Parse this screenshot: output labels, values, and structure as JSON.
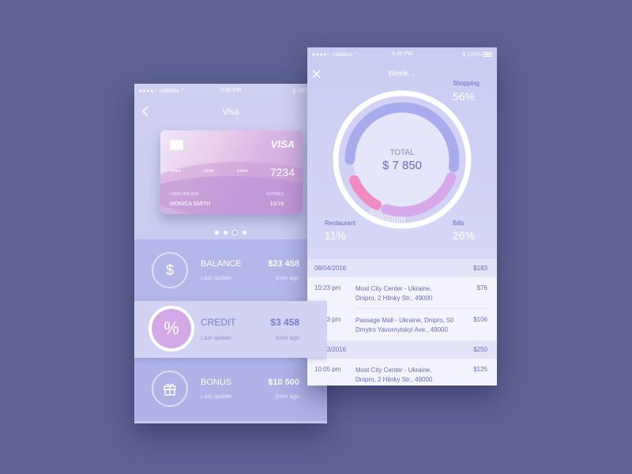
{
  "left_screen": {
    "status": {
      "carrier": "cadabra",
      "time": "9:40 PM",
      "battery": "100%"
    },
    "nav": {
      "title": "Visa"
    },
    "card": {
      "brand": "VISA",
      "masked_groups": [
        "****",
        "****",
        "****"
      ],
      "last_digits": "7234",
      "holder_label": "CARD HOLDER",
      "holder": "MONICA SMITH",
      "expiry_label": "EXPIRES",
      "expiry": "10/19"
    },
    "pager": {
      "count": 4,
      "active_index": 2
    },
    "accounts": [
      {
        "name": "BALANCE",
        "subtitle": "Last update",
        "amount": "$23 458",
        "time": "1min ago",
        "icon": "dollar-icon",
        "glyph": "$"
      },
      {
        "name": "CREDIT",
        "subtitle": "Last update",
        "amount": "$3 458",
        "time": "1min ago",
        "icon": "percent-icon",
        "glyph": "%"
      },
      {
        "name": "BONUS",
        "subtitle": "Last update",
        "amount": "$10 500",
        "time": "2min ago",
        "icon": "gift-icon",
        "glyph": "🎁"
      }
    ]
  },
  "right_screen": {
    "status": {
      "carrier": "cadabra",
      "time": "9:40 PM",
      "battery": "100%"
    },
    "nav": {
      "period": "Week"
    },
    "chart_data": {
      "type": "pie",
      "center_label": "TOTAL",
      "center_value": "$ 7 850",
      "slices": [
        {
          "name": "Shopping",
          "percent": 56,
          "label": "56%",
          "color": "#a9acec"
        },
        {
          "name": "Bills",
          "percent": 26,
          "label": "26%",
          "color": "#d7a8ea"
        },
        {
          "name": "Restaurant",
          "percent": 11,
          "label": "11%",
          "color": "#f08cc0"
        }
      ]
    },
    "transactions": [
      {
        "date": "08/04/2016",
        "total": "$183",
        "items": [
          {
            "time": "10:23 pm",
            "place_line1": "Most City Center - Ukraine,",
            "place_line2": "Dnipro, 2 Hlinky Str., 49000",
            "amount": "$76"
          },
          {
            "time": "09:13 pm",
            "place_line1": "Passage Mall - Ukraine, Dnipro, 50",
            "place_line2": "Dmytro Yavornytskyi Ave., 49000",
            "amount": "$106"
          }
        ]
      },
      {
        "date": "08/03/2016",
        "total": "$250",
        "items": [
          {
            "time": "10:05 pm",
            "place_line1": "Most City Center - Ukraine,",
            "place_line2": "Dnipro, 2 Hlinky Str., 49000",
            "amount": "$125"
          }
        ]
      }
    ]
  }
}
